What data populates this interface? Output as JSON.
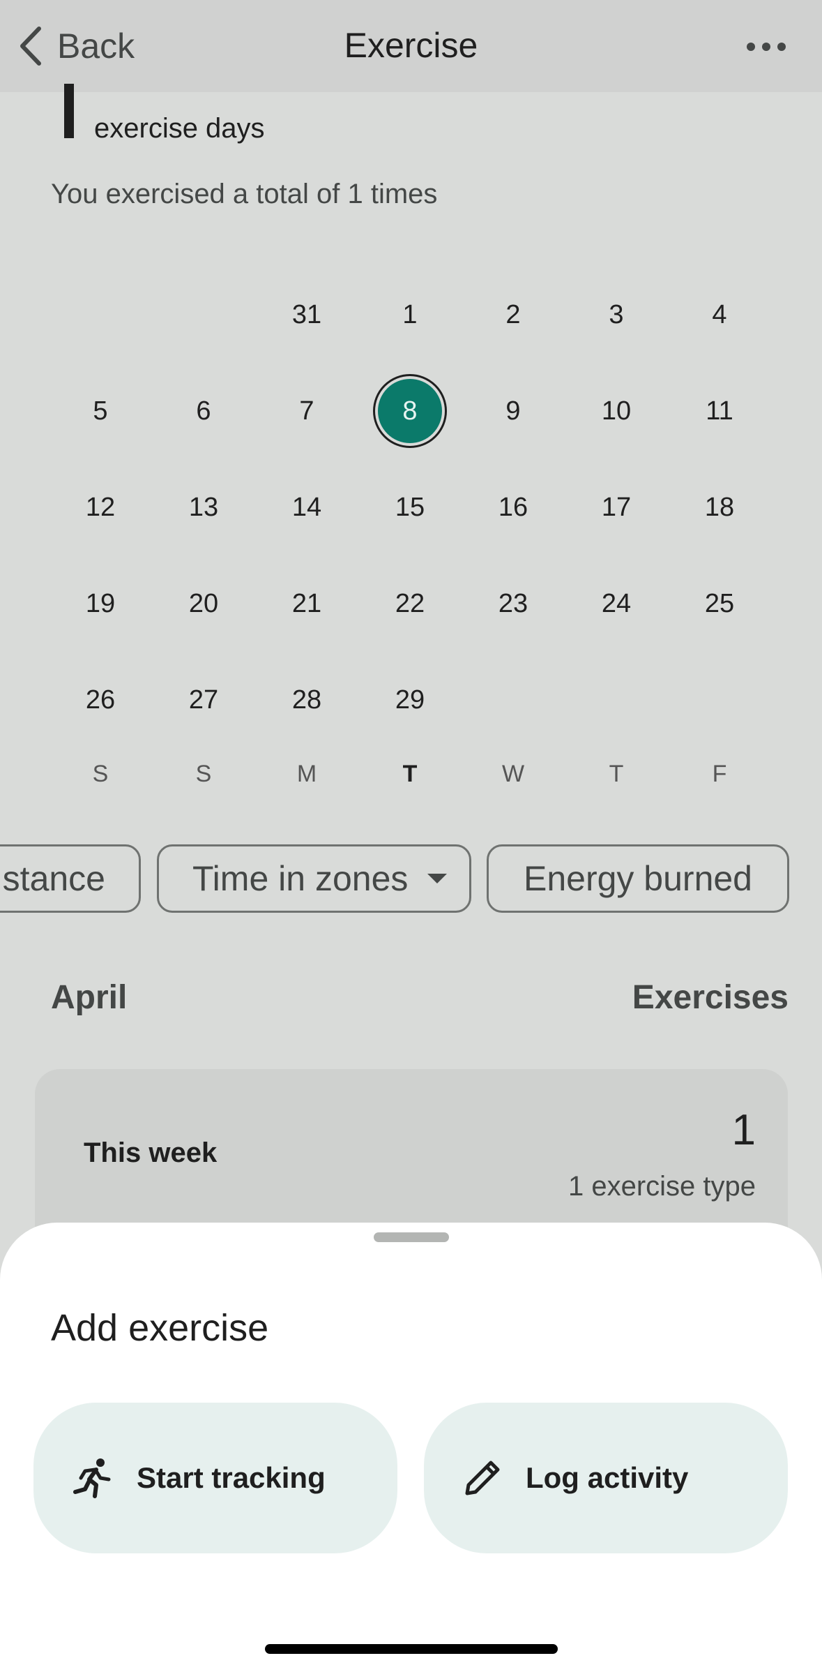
{
  "nav": {
    "back_label": "Back",
    "title": "Exercise"
  },
  "summary": {
    "count": "1",
    "count_label": "exercise days",
    "total_text": "You exercised a total of 1 times"
  },
  "calendar": {
    "rows": [
      [
        "",
        "",
        "31",
        "1",
        "2",
        "3",
        "4"
      ],
      [
        "5",
        "6",
        "7",
        "8",
        "9",
        "10",
        "11"
      ],
      [
        "12",
        "13",
        "14",
        "15",
        "16",
        "17",
        "18"
      ],
      [
        "19",
        "20",
        "21",
        "22",
        "23",
        "24",
        "25"
      ],
      [
        "26",
        "27",
        "28",
        "29",
        "",
        "",
        ""
      ]
    ],
    "selected": "8",
    "selected_color": "#0b7a6a",
    "weekdays": [
      "S",
      "S",
      "M",
      "T",
      "W",
      "T",
      "F"
    ],
    "current_weekday_index": 3
  },
  "chips": {
    "distance": "stance",
    "zones": "Time in zones",
    "energy": "Energy burned"
  },
  "section": {
    "month": "April",
    "metric": "Exercises"
  },
  "week_card": {
    "label": "This week",
    "value": "1",
    "sub": "1 exercise type"
  },
  "sheet": {
    "title": "Add exercise",
    "start_tracking": "Start tracking",
    "log_activity": "Log activity"
  }
}
